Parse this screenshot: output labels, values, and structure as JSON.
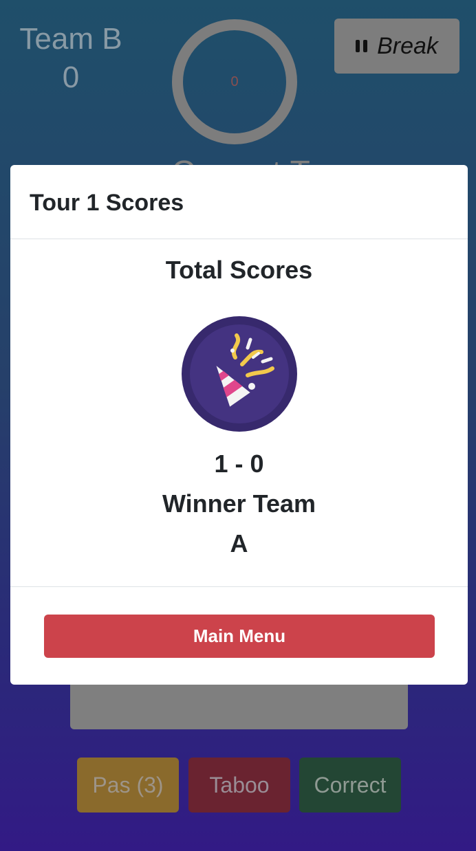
{
  "background": {
    "team": {
      "name": "Team B",
      "score": "0"
    },
    "timer": {
      "value": "0"
    },
    "break_button": {
      "label": "Break",
      "icon": "pause-icon"
    },
    "partial_heading": "Current T",
    "buttons": {
      "pass": "Pas (3)",
      "taboo": "Taboo",
      "correct": "Correct"
    }
  },
  "modal": {
    "title": "Tour 1 Scores",
    "total_title": "Total Scores",
    "icon": "party-popper-icon",
    "scoreline": "1 - 0",
    "winner_label": "Winner Team",
    "winner_team": "A",
    "main_menu_label": "Main Menu"
  },
  "colors": {
    "danger": "#cc434b",
    "icon_bg": "#37296d",
    "popper_pink": "#e0468c",
    "confetti_yellow": "#f2c94c"
  }
}
